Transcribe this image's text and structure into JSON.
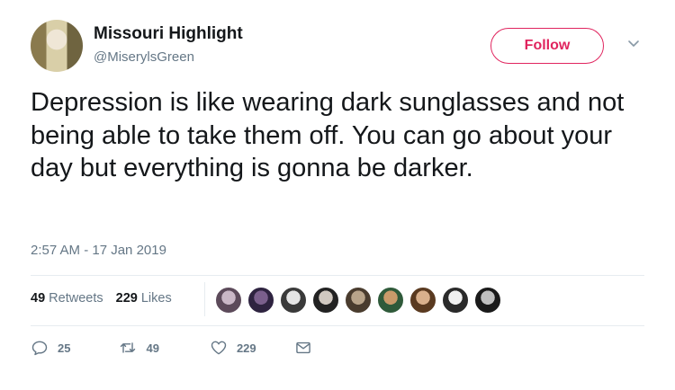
{
  "author": {
    "name": "Missouri Highlight",
    "handle": "@MiserylsGreen"
  },
  "follow_label": "Follow",
  "tweet": {
    "text": "Depression is like wearing dark sunglasses and not being able to take them off. You can go about your day but everything is gonna be darker.",
    "timestamp": "2:57 AM - 17 Jan 2019"
  },
  "stats": {
    "retweets_count": "49",
    "retweets_label": "Retweets",
    "likes_count": "229",
    "likes_label": "Likes"
  },
  "actions": {
    "reply_count": "25",
    "retweet_count": "49",
    "like_count": "229"
  },
  "icons": [
    "chevron-down-icon",
    "reply-icon",
    "retweet-icon",
    "heart-icon",
    "message-icon"
  ],
  "colors": {
    "follow_accent": "#e0245e",
    "secondary_text": "#657786",
    "primary_text": "#14171a"
  }
}
